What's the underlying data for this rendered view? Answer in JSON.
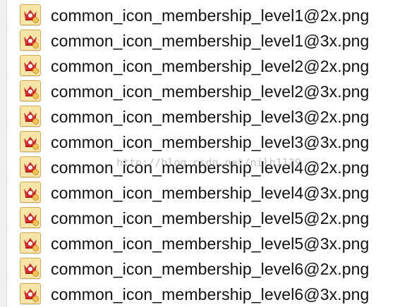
{
  "files": [
    {
      "name": "common_icon_membership_level1@2x.png",
      "icon": "crown-icon"
    },
    {
      "name": "common_icon_membership_level1@3x.png",
      "icon": "crown-icon"
    },
    {
      "name": "common_icon_membership_level2@2x.png",
      "icon": "crown-icon"
    },
    {
      "name": "common_icon_membership_level2@3x.png",
      "icon": "crown-icon"
    },
    {
      "name": "common_icon_membership_level3@2x.png",
      "icon": "crown-icon"
    },
    {
      "name": "common_icon_membership_level3@3x.png",
      "icon": "crown-icon"
    },
    {
      "name": "common_icon_membership_level4@2x.png",
      "icon": "crown-icon"
    },
    {
      "name": "common_icon_membership_level4@3x.png",
      "icon": "crown-icon"
    },
    {
      "name": "common_icon_membership_level5@2x.png",
      "icon": "crown-icon"
    },
    {
      "name": "common_icon_membership_level5@3x.png",
      "icon": "crown-icon"
    },
    {
      "name": "common_icon_membership_level6@2x.png",
      "icon": "crown-icon"
    },
    {
      "name": "common_icon_membership_level6@3x.png",
      "icon": "crown-icon"
    }
  ],
  "watermark": "http://blog.csdn.net/nilh1129",
  "colors": {
    "crown": "#d62a2a",
    "icon_background": "#f6e5a6",
    "text": "#111111"
  }
}
